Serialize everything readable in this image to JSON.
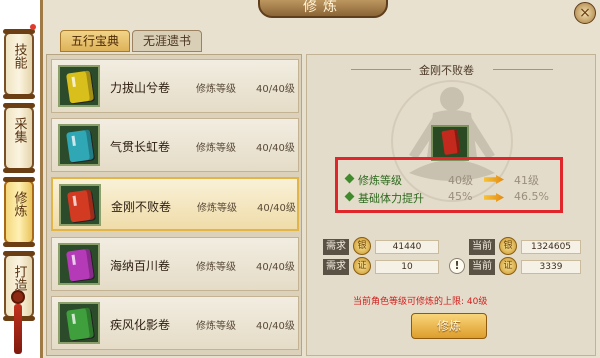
{
  "window": {
    "title": "修炼",
    "close_glyph": "×"
  },
  "side_nav": [
    {
      "label": "技能",
      "active": false
    },
    {
      "label": "采集",
      "active": false
    },
    {
      "label": "修炼",
      "active": true
    },
    {
      "label": "打造",
      "active": false
    }
  ],
  "tabs": [
    {
      "label": "五行宝典",
      "active": true
    },
    {
      "label": "无涯遗书",
      "active": false
    }
  ],
  "books": [
    {
      "name": "力拔山兮卷",
      "level_label": "修炼等级",
      "level": "40/40级",
      "color": "#d9bf1c",
      "selected": false
    },
    {
      "name": "气贯长虹卷",
      "level_label": "修炼等级",
      "level": "40/40级",
      "color": "#2fa7b5",
      "selected": false
    },
    {
      "name": "金刚不败卷",
      "level_label": "修炼等级",
      "level": "40/40级",
      "color": "#d23a22",
      "selected": true
    },
    {
      "name": "海纳百川卷",
      "level_label": "修炼等级",
      "level": "40/40级",
      "color": "#b43ab8",
      "selected": false
    },
    {
      "name": "疾风化影卷",
      "level_label": "修炼等级",
      "level": "40/40级",
      "color": "#3e9f3c",
      "selected": false
    }
  ],
  "detail": {
    "title": "金刚不败卷",
    "stats": [
      {
        "name": "修炼等级",
        "current": "40级",
        "next": "41级"
      },
      {
        "name": "基础体力提升",
        "current": "45%",
        "next": "46.5%"
      }
    ],
    "requirements": [
      {
        "need_label": "需求",
        "need_icon": "银",
        "need_value": "41440",
        "current_label": "当前",
        "current_icon": "银",
        "current_value": "1324605"
      },
      {
        "need_label": "需求",
        "need_icon": "证",
        "need_value": "10",
        "current_label": "当前",
        "current_icon": "证",
        "current_value": "3339"
      }
    ],
    "warning_glyph": "!",
    "notice": "当前角色等级可修炼的上限: 40级",
    "train_button": "修炼"
  },
  "colors": {
    "highlight_box": "#e0262b",
    "stat_name": "#2d6a1e",
    "notice": "#d0201e"
  }
}
